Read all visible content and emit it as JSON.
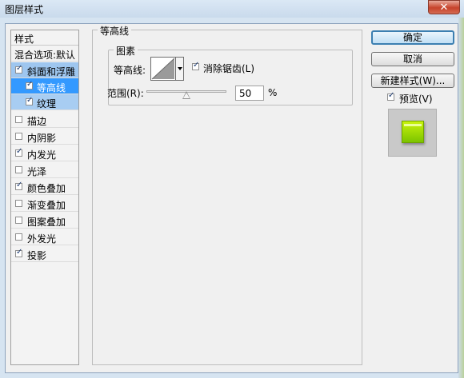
{
  "window": {
    "title": "图层样式",
    "close_glyph": "✕"
  },
  "styles_list": {
    "header": "样式",
    "blending_default": "混合选项:默认",
    "items": [
      {
        "label": "斜面和浮雕",
        "checked": true
      },
      {
        "label": "等高线",
        "checked": true
      },
      {
        "label": "纹理",
        "checked": true
      },
      {
        "label": "描边",
        "checked": false
      },
      {
        "label": "内阴影",
        "checked": false
      },
      {
        "label": "内发光",
        "checked": true
      },
      {
        "label": "光泽",
        "checked": false
      },
      {
        "label": "颜色叠加",
        "checked": true
      },
      {
        "label": "渐变叠加",
        "checked": false
      },
      {
        "label": "图案叠加",
        "checked": false
      },
      {
        "label": "外发光",
        "checked": false
      },
      {
        "label": "投影",
        "checked": true
      }
    ]
  },
  "contour_panel": {
    "group_title": "等高线",
    "elements_title": "图素",
    "contour_label": "等高线:",
    "antialias_label": "消除锯齿(L)",
    "antialias_checked": true,
    "range_label": "范围(R):",
    "range_value": "50",
    "range_unit": "%",
    "range_fraction": 0.5
  },
  "buttons": {
    "ok": "确定",
    "cancel": "取消",
    "new_style": "新建样式(W)...",
    "preview_label": "预览(V)",
    "preview_checked": true
  },
  "colors": {
    "selection": "#3399ff",
    "selection_light": "#9ec6ef",
    "preview_green": "#a6df06"
  }
}
